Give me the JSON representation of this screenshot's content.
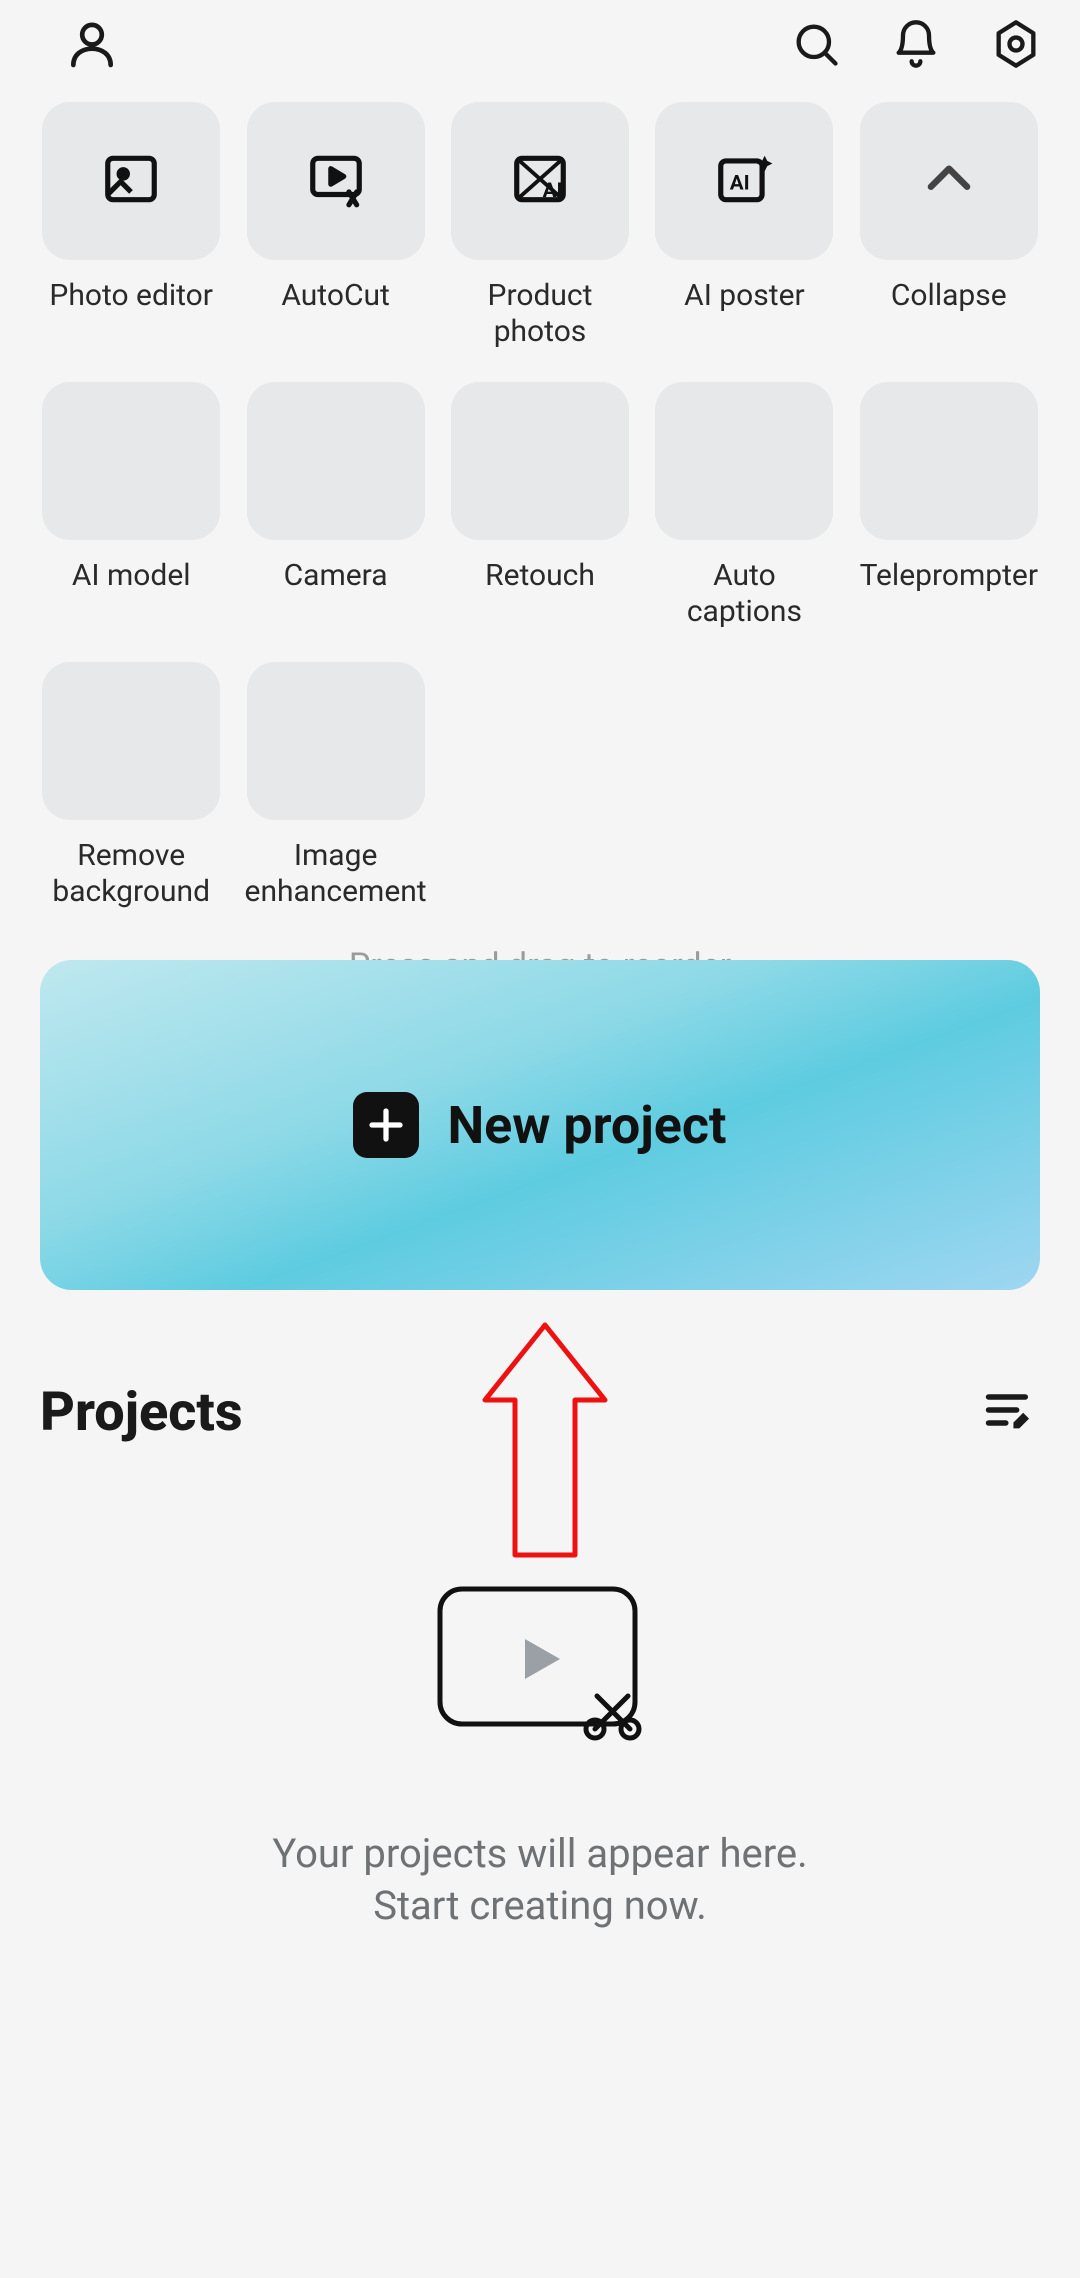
{
  "tools": [
    {
      "label": "Photo editor"
    },
    {
      "label": "AutoCut"
    },
    {
      "label": "Product photos"
    },
    {
      "label": "AI poster"
    },
    {
      "label": "Collapse"
    },
    {
      "label": "AI model"
    },
    {
      "label": "Camera"
    },
    {
      "label": "Retouch"
    },
    {
      "label": "Auto captions"
    },
    {
      "label": "Teleprompter"
    },
    {
      "label": "Remove background"
    },
    {
      "label": "Image enhancement"
    }
  ],
  "reorder_hint": "Press and drag to reorder",
  "new_project_label": "New project",
  "projects_title": "Projects",
  "empty_line1": "Your projects will appear here.",
  "empty_line2": "Start creating now."
}
